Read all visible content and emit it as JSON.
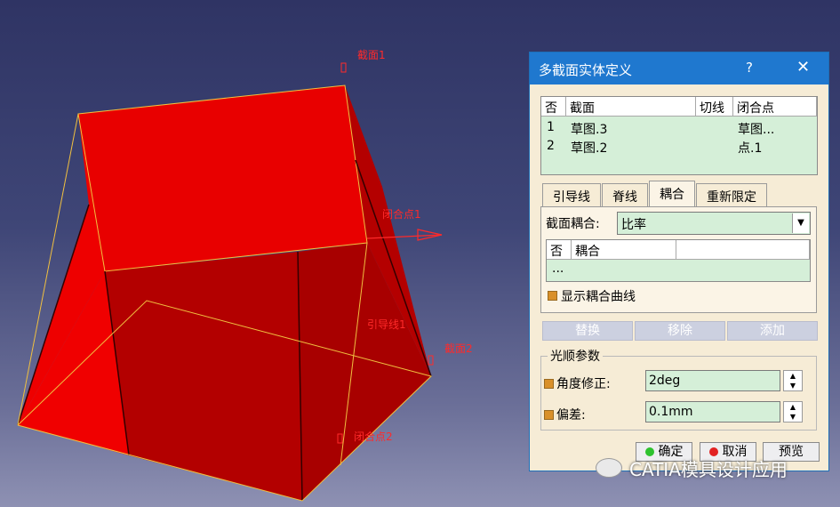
{
  "viewport": {
    "labels": {
      "section1": "截面1",
      "closing_point1": "闭合点1",
      "guide1": "引导线1",
      "section2": "截面2",
      "closing_point2": "闭合点2"
    },
    "colors": {
      "solid_red": "#e60000",
      "solid_dark": "#a80000",
      "annotation": "#ff2a2a",
      "guide_line": "#f0c040"
    }
  },
  "dialog": {
    "title": "多截面实体定义",
    "help": "?",
    "close": "✕",
    "section_table": {
      "headers": [
        "否",
        "截面",
        "切线",
        "闭合点"
      ],
      "rows": [
        {
          "no": "1",
          "section": "草图.3",
          "tangent": "",
          "closing_point": "草图..."
        },
        {
          "no": "2",
          "section": "草图.2",
          "tangent": "",
          "closing_point": "点.1"
        }
      ]
    },
    "tabs": [
      "引导线",
      "脊线",
      "耦合",
      "重新限定"
    ],
    "active_tab": "耦合",
    "coupling": {
      "label": "截面耦合:",
      "value": "比率",
      "table_headers": [
        "否",
        "耦合"
      ],
      "table_row": "...",
      "show_curves_label": "显示耦合曲线"
    },
    "buttons": {
      "replace": "替换",
      "remove": "移除",
      "add": "添加"
    },
    "smooth": {
      "group_title": "光顺参数",
      "angle_label": "角度修正:",
      "angle_value": "2deg",
      "deviation_label": "偏差:",
      "deviation_value": "0.1mm"
    },
    "footer": {
      "ok": "确定",
      "cancel": "取消",
      "preview": "预览"
    },
    "colors": {
      "title_bar": "#1f78cf",
      "field_green": "#d5efd8",
      "panel": "#f6ecd6",
      "ok_dot": "#2ec22e",
      "cancel_dot": "#e22222"
    }
  },
  "watermark": {
    "text": "CATIA模具设计应用"
  }
}
